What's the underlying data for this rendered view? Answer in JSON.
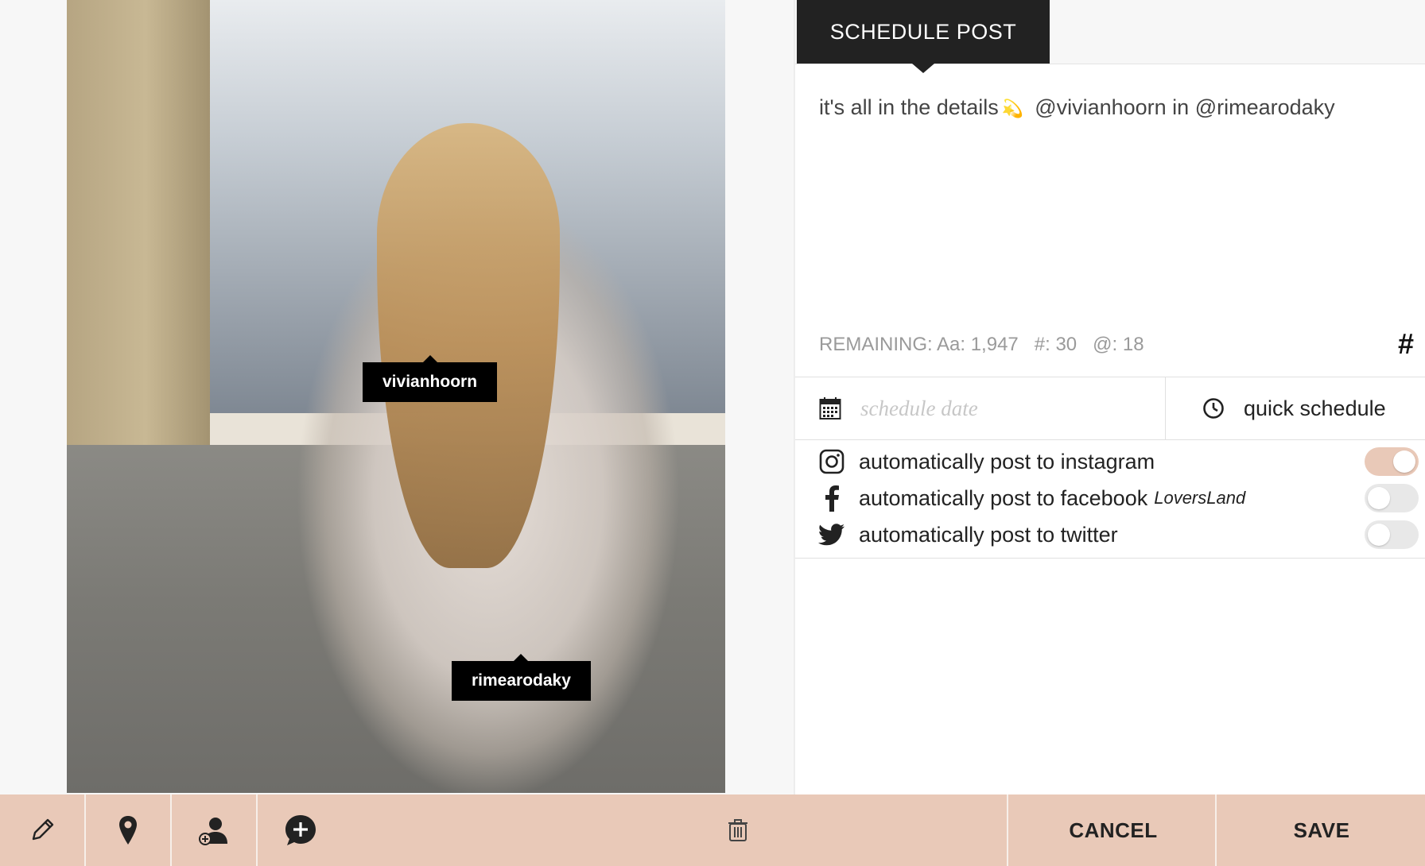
{
  "photo": {
    "tags": [
      "vivianhoorn",
      "rimearodaky"
    ]
  },
  "toolbar": {
    "edit_icon": "pencil-icon",
    "location_icon": "map-pin-icon",
    "tag_user_icon": "add-user-icon",
    "comment_icon": "add-comment-icon",
    "delete_icon": "trash-icon"
  },
  "schedule": {
    "tab_label": "SCHEDULE POST",
    "caption_text": "it's all in the details",
    "caption_mentions": "@vivianhoorn in @rimearodaky",
    "remaining": "REMAINING: Aa: 1,947   #: 30   @: 18",
    "hashtag_button": "#",
    "date_placeholder": "schedule date",
    "quick_schedule": "quick schedule",
    "social": [
      {
        "label": "automatically post to instagram",
        "page": "",
        "enabled": true
      },
      {
        "label": "automatically post to facebook",
        "page": "LoversLand",
        "enabled": false
      },
      {
        "label": "automatically post to twitter",
        "page": "",
        "enabled": false
      }
    ]
  },
  "actions": {
    "cancel": "CANCEL",
    "save": "SAVE"
  },
  "colors": {
    "accent": "#e9c9b8",
    "dark": "#222222",
    "tag_bg": "#000000"
  }
}
